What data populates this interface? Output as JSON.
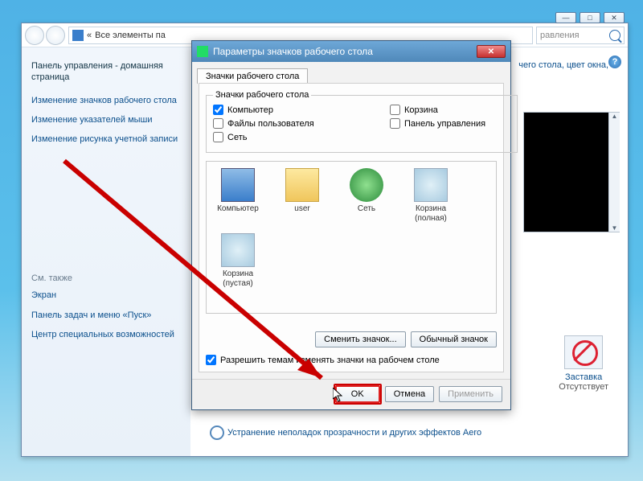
{
  "window_buttons": {
    "minimize": "—",
    "maximize": "□",
    "close": "✕"
  },
  "breadcrumb": {
    "prefix": "«",
    "text": "Все элементы па"
  },
  "search": {
    "placeholder": "равления"
  },
  "sidebar": {
    "home": "Панель управления - домашняя страница",
    "links": [
      "Изменение значков рабочего стола",
      "Изменение указателей мыши",
      "Изменение рисунка учетной записи"
    ],
    "see_also_heading": "См. также",
    "see_also": [
      "Экран",
      "Панель задач и меню «Пуск»",
      "Центр специальных возможностей"
    ]
  },
  "main": {
    "hint": "чего стола, цвет окна,",
    "saver_label": "Заставка",
    "saver_status": "Отсутствует",
    "footer_link": "Устранение неполадок прозрачности и других эффектов Aero"
  },
  "dialog": {
    "title": "Параметры значков рабочего стола",
    "tab": "Значки рабочего стола",
    "group": "Значки рабочего стола",
    "checks": {
      "computer": "Компьютер",
      "recycle": "Корзина",
      "userfiles": "Файлы пользователя",
      "cpanel": "Панель управления",
      "network": "Сеть"
    },
    "icons": [
      "Компьютер",
      "user",
      "Сеть",
      "Корзина (полная)",
      "Корзина (пустая)"
    ],
    "btn_change": "Сменить значок...",
    "btn_default": "Обычный значок",
    "allow_themes": "Разрешить темам изменять значки на рабочем столе",
    "ok": "OK",
    "cancel": "Отмена",
    "apply": "Применить"
  }
}
